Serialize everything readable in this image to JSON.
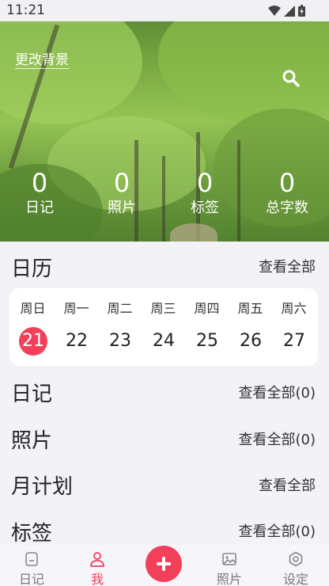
{
  "status_bar": {
    "time": "11:21"
  },
  "header": {
    "change_bg": "更改背景",
    "stats": [
      {
        "value": "0",
        "label": "日记"
      },
      {
        "value": "0",
        "label": "照片"
      },
      {
        "value": "0",
        "label": "标签"
      },
      {
        "value": "0",
        "label": "总字数"
      }
    ]
  },
  "calendar": {
    "title": "日历",
    "view_all": "查看全部",
    "days": [
      {
        "weekday": "周日",
        "date": "21",
        "today": true
      },
      {
        "weekday": "周一",
        "date": "22"
      },
      {
        "weekday": "周二",
        "date": "23"
      },
      {
        "weekday": "周三",
        "date": "24"
      },
      {
        "weekday": "周四",
        "date": "25"
      },
      {
        "weekday": "周五",
        "date": "26"
      },
      {
        "weekday": "周六",
        "date": "27"
      }
    ]
  },
  "diary": {
    "title": "日记",
    "view_all": "查看全部(0)"
  },
  "photos": {
    "title": "照片",
    "view_all": "查看全部(0)"
  },
  "monthly_plan": {
    "title": "月计划",
    "view_all": "查看全部"
  },
  "tags": {
    "title": "标签",
    "view_all": "查看全部(0)"
  },
  "tabbar": {
    "diary": "日记",
    "me": "我",
    "photos": "照片",
    "settings": "设定"
  },
  "colors": {
    "accent": "#f2405b",
    "background": "#f3f2f7"
  }
}
